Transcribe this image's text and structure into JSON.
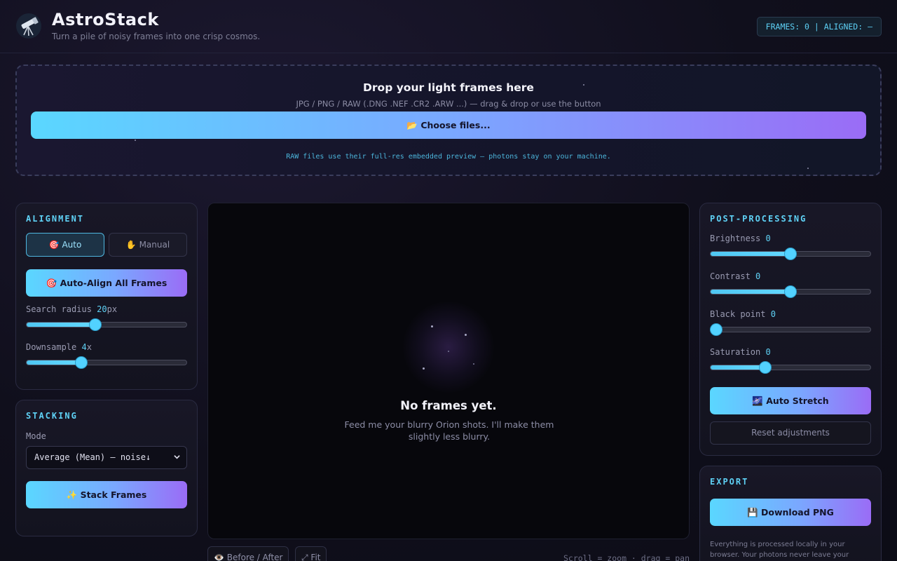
{
  "header": {
    "title": "AstroStack",
    "subtitle": "Turn a pile of noisy frames into one crisp cosmos.",
    "status": "FRAMES: 0 | ALIGNED: —",
    "logo_icon": "telescope-icon"
  },
  "dropzone": {
    "title": "Drop your light frames here",
    "hint": "JPG / PNG / RAW (.DNG .NEF .CR2 .ARW ...) — drag & drop or use the button",
    "choose_label": "📂 Choose files...",
    "note": "RAW files use their full-res embedded preview — photons stay on your machine."
  },
  "alignment": {
    "title": "ALIGNMENT",
    "mode_auto": "🎯 Auto",
    "mode_manual": "✋ Manual",
    "auto_align_label": "🎯 Auto-Align All Frames",
    "search_radius": {
      "label": "Search radius",
      "value": "20",
      "unit": "px",
      "level": 0.43
    },
    "downsample": {
      "label": "Downsample",
      "value": "4",
      "unit": "x",
      "level": 0.34
    }
  },
  "stacking": {
    "title": "STACKING",
    "mode_label": "Mode",
    "mode_value": "Average (Mean) — noise↓",
    "stack_label": "✨ Stack Frames"
  },
  "canvas": {
    "empty_title": "No frames yet.",
    "empty_text": "Feed me your blurry Orion shots. I'll make them slightly less blurry."
  },
  "toolbar": {
    "before_after": "👁️ Before / After",
    "fit": "⤢ Fit",
    "hint": "Scroll = zoom · drag = pan"
  },
  "post": {
    "title": "POST-PROCESSING",
    "brightness": {
      "label": "Brightness",
      "value": "0",
      "level": 0.5
    },
    "contrast": {
      "label": "Contrast",
      "value": "0",
      "level": 0.5
    },
    "black_point": {
      "label": "Black point",
      "value": "0",
      "level": 0.0
    },
    "saturation": {
      "label": "Saturation",
      "value": "0",
      "level": 0.34
    },
    "auto_stretch_label": "🌌 Auto Stretch",
    "reset_label": "Reset adjustments"
  },
  "export": {
    "title": "EXPORT",
    "download_label": "💾 Download PNG",
    "note": "Everything is processed locally in your browser. Your photons never leave your machine."
  },
  "colors": {
    "accent_cyan": "#5ad7ff",
    "accent_purple": "#9a6cf6",
    "background": "#0f0e1a"
  }
}
